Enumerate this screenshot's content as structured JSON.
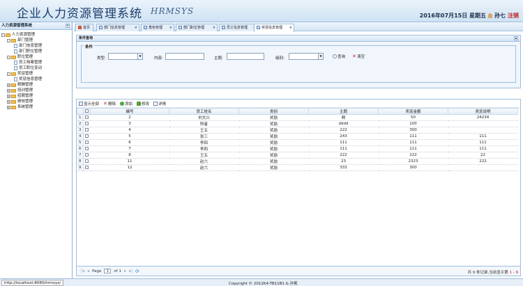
{
  "header": {
    "title": "企业人力资源管理系统",
    "title_en": "HRMSYS",
    "date_text": "2016年07月15日 星期五",
    "username": "孙七",
    "logout_label": "注销"
  },
  "sidebar": {
    "title": "人力资源管理系统",
    "root": "人力资源管理",
    "items": [
      {
        "label": "部门管理",
        "level": 1,
        "pm": "-"
      },
      {
        "label": "部门信息管理",
        "level": 2
      },
      {
        "label": "部门职位管理",
        "level": 2
      },
      {
        "label": "职位管理",
        "level": 1,
        "pm": "-"
      },
      {
        "label": "员工档案管理",
        "level": 2
      },
      {
        "label": "员工职位变动",
        "level": 2
      },
      {
        "label": "奖惩管理",
        "level": 1,
        "pm": "-"
      },
      {
        "label": "奖惩信息管理",
        "level": 2
      },
      {
        "label": "薪酬管理",
        "level": 1,
        "pm": "+"
      },
      {
        "label": "培训管理",
        "level": 1,
        "pm": "+"
      },
      {
        "label": "招聘管理",
        "level": 1,
        "pm": "+"
      },
      {
        "label": "绩效管理",
        "level": 1,
        "pm": "+"
      },
      {
        "label": "系统管理",
        "level": 1,
        "pm": "+"
      }
    ]
  },
  "tabs": [
    {
      "label": "首页"
    },
    {
      "label": "部门信息管理"
    },
    {
      "label": "角色管理"
    },
    {
      "label": "部门职位管理"
    },
    {
      "label": "员工信息管理"
    },
    {
      "label": "奖惩信息管理"
    }
  ],
  "search": {
    "panel_title": "条件查询",
    "legend": "条件",
    "field_labels": [
      "类型:",
      "内容:",
      "主题:",
      "级别:"
    ],
    "query_label": "查询",
    "clear_label": "清空"
  },
  "toolbar": {
    "show_all": "显示全部",
    "delete": "删除",
    "add": "添加",
    "edit": "修改",
    "detail": "详情"
  },
  "table": {
    "headers": [
      "编号",
      "员工姓名",
      "类别",
      "主题",
      "奖惩金额",
      "奖惩说明"
    ],
    "rows": [
      {
        "n": "1",
        "c": [
          "2",
          "刘文兴",
          "奖励",
          "啊",
          "50",
          "24234"
        ]
      },
      {
        "n": "2",
        "c": [
          "3",
          "阿者",
          "奖励",
          "dddd",
          "100",
          ""
        ]
      },
      {
        "n": "3",
        "c": [
          "4",
          "王五",
          "奖励",
          "222",
          "300",
          ""
        ]
      },
      {
        "n": "4",
        "c": [
          "5",
          "张三",
          "奖励",
          "243",
          "111",
          "111"
        ]
      },
      {
        "n": "5",
        "c": [
          "6",
          "李四",
          "奖励",
          "111",
          "111",
          "111"
        ]
      },
      {
        "n": "6",
        "c": [
          "7",
          "李四",
          "奖励",
          "111",
          "111",
          "111"
        ]
      },
      {
        "n": "7",
        "c": [
          "8",
          "王五",
          "奖励",
          "222",
          "222",
          "22"
        ]
      },
      {
        "n": "8",
        "c": [
          "11",
          "赵六",
          "奖励",
          "23",
          "2323",
          "222"
        ]
      },
      {
        "n": "9",
        "c": [
          "12",
          "赵六",
          "奖励",
          "333",
          "300",
          ""
        ]
      }
    ]
  },
  "pager": {
    "page_label": "Page",
    "page_value": "1",
    "of_label": "of 1",
    "info_prefix": "共 9 条记录,当前显示第",
    "info_range": "1 - 9"
  },
  "status": {
    "url": "http://localhost:8080/hrmsys/",
    "copyright": "Copyright © 2012K4-TB11B1 & 孙冕"
  }
}
